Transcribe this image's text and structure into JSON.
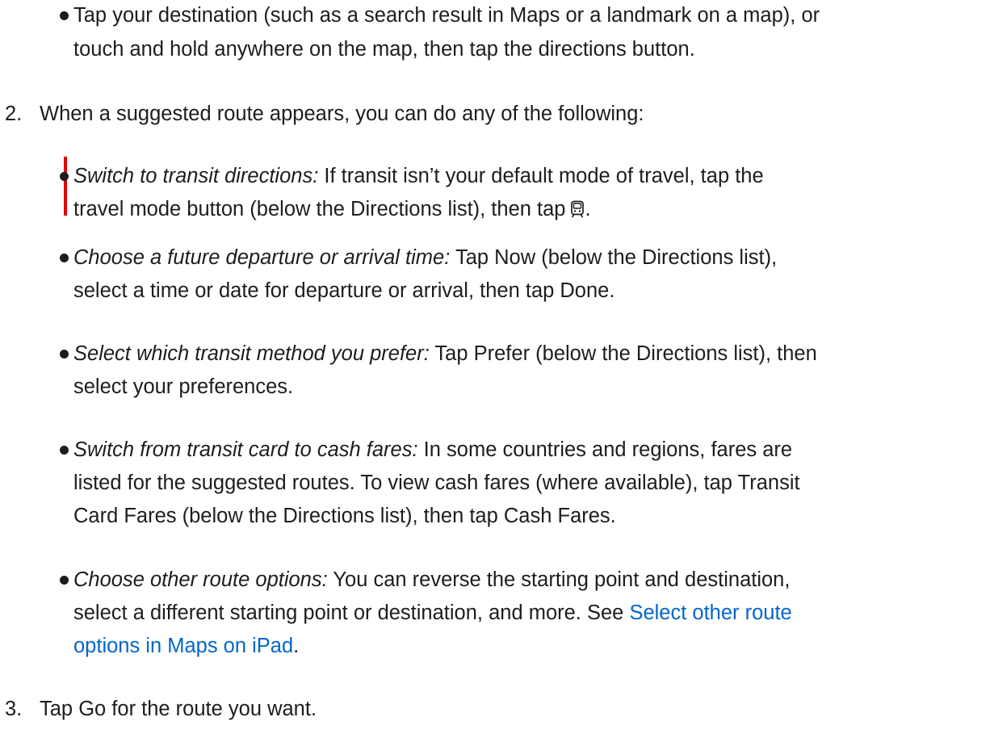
{
  "top_bullet": {
    "line1": "Tap your destination (such as a search result in Maps or a landmark on a map), or",
    "line2": "touch and hold anywhere on the map, then tap the directions button."
  },
  "step2": {
    "number": "2.",
    "text": "When a suggested route appears, you can do any of the following:",
    "options": [
      {
        "lead": "Switch to transit directions:",
        "line1": "If transit isn’t your default mode of travel, tap the",
        "line2": "travel mode button (below the Directions list), then tap",
        "icon": "train-icon",
        "tail": "."
      },
      {
        "lead": "Choose a future departure or arrival time:",
        "line1": "Tap Now (below the Directions list),",
        "line2": "select a time or date for departure or arrival, then tap Done."
      },
      {
        "lead": "Select which transit method you prefer:",
        "line1": "Tap Prefer (below the Directions list), then",
        "line2": "select your preferences."
      },
      {
        "lead": "Switch from transit card to cash fares:",
        "line1": "In some countries and regions, fares are",
        "line2": "listed for the suggested routes. To view cash fares (where available), tap Transit",
        "line3": "Card Fares (below the Directions list), then tap Cash Fares."
      },
      {
        "lead": "Choose other route options:",
        "line1": "You can reverse the starting point and destination,",
        "line2": "select a different starting point or destination, and more. See",
        "link_part1": "Select other route",
        "link_part2": "options in Maps on iPad",
        "tail": "."
      }
    ]
  },
  "step3": {
    "number": "3.",
    "text": "Tap Go for the route you want."
  },
  "colors": {
    "text": "#1d1d1f",
    "link": "#0066cc",
    "highlight_marker": "#e30000"
  }
}
